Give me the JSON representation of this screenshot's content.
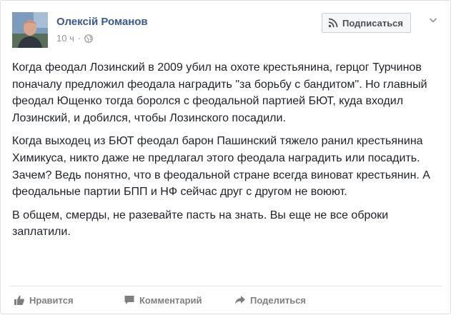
{
  "post": {
    "author": "Олексій Романов",
    "time": "10 ч",
    "dot": "·",
    "privacy_icon": "globe-icon",
    "subscribe_label": "Подписаться",
    "subscribe_icon": "rss-icon",
    "menu_icon": "chevron-down-icon",
    "paragraphs": [
      "Когда феодал Лозинский в 2009 убил на охоте крестьянина, герцог Турчинов поначалу предложил феодала наградить \"за борьбу с бандитом\". Но главный феодал Ющенко тогда боролся с феодальной партией БЮТ, куда входил Лозинский, и добился, чтобы Лозинского посадили.",
      "Когда выходец из БЮТ феодал барон Пашинский тяжело ранил крестьянина Химикуса, никто даже не предлагал этого феодала наградить или посадить. Зачем? Ведь понятно, что в феодальной стране всегда виноват крестьянин. А феодальные партии БПП и НФ сейчас друг с другом не воюют.",
      "В общем, смерды, не разевайте пасть на знать. Вы еще не все оброки заплатили."
    ]
  },
  "actions": {
    "like": {
      "label": "Нравится",
      "icon": "thumbs-up-icon"
    },
    "comment": {
      "label": "Комментарий",
      "icon": "comment-icon"
    },
    "share": {
      "label": "Поделиться",
      "icon": "share-icon"
    }
  },
  "colors": {
    "author_link": "#365899",
    "meta_gray": "#90949c",
    "action_gray": "#7f7f7f",
    "body_text": "#1d2129"
  }
}
